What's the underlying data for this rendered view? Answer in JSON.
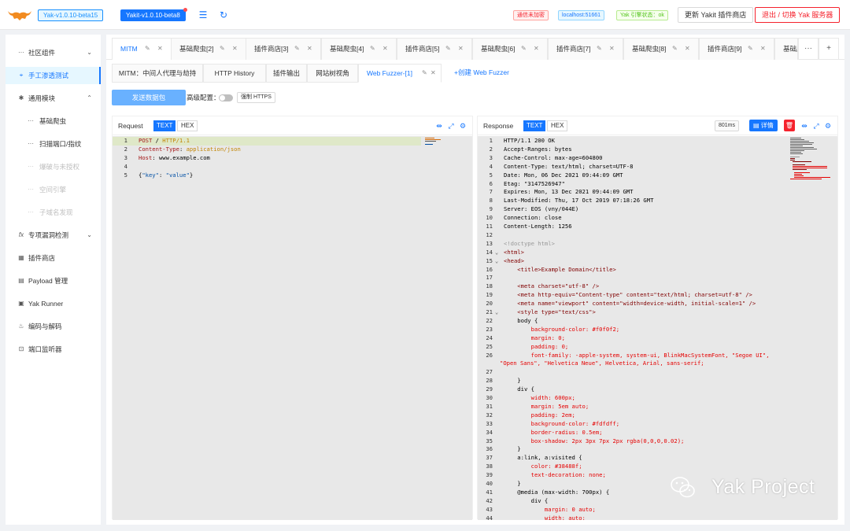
{
  "top": {
    "version_tag": "Yak-v1.0.10-beta15",
    "version_active": "Yakit-v1.0.10-beta8",
    "status_tags": [
      {
        "label": "通信未加密",
        "tone": "red"
      },
      {
        "label": "localhost:51661",
        "tone": "blue"
      },
      {
        "label": "Yak 引擎状态：ok",
        "tone": "green"
      }
    ],
    "update_label": "更新 Yakit 插件商店",
    "logout_label": "退出 / 切换 Yak 服务器",
    "accent": "#1677ff",
    "danger": "#f5222d"
  },
  "sidebar": {
    "items": [
      {
        "label": "社区组件",
        "icon": "ellipsis-icon",
        "arrow": "⌄"
      },
      {
        "label": "手工渗透测试",
        "icon": "target-icon",
        "active": true
      },
      {
        "label": "通用模块",
        "icon": "bug-icon",
        "arrow": "⌃"
      },
      {
        "label": "基础爬虫",
        "icon": "ellipsis-icon",
        "sub": true
      },
      {
        "label": "扫描端口/指纹",
        "icon": "ellipsis-icon",
        "sub": true
      },
      {
        "label": "爆破与未授权",
        "icon": "ellipsis-icon",
        "sub": true,
        "disabled": true
      },
      {
        "label": "空间引擎",
        "icon": "ellipsis-icon",
        "sub": true,
        "disabled": true
      },
      {
        "label": "子域名发现",
        "icon": "ellipsis-icon",
        "sub": true,
        "disabled": true
      },
      {
        "label": "专项漏洞检测",
        "icon": "function-icon",
        "arrow": "⌄"
      },
      {
        "label": "插件商店",
        "icon": "grid-icon"
      },
      {
        "label": "Payload 管理",
        "icon": "file-icon"
      },
      {
        "label": "Yak Runner",
        "icon": "terminal-icon"
      },
      {
        "label": "编码与解码",
        "icon": "fire-icon"
      },
      {
        "label": "端口监听器",
        "icon": "listen-icon"
      }
    ]
  },
  "tabs1": [
    "MITM",
    "基础爬虫[2]",
    "插件商店[3]",
    "基础爬虫[4]",
    "插件商店[5]",
    "基础爬虫[6]",
    "插件商店[7]",
    "基础爬虫[8]",
    "插件商店[9]",
    "基础爬"
  ],
  "tabs2": {
    "items": [
      "MITM：中间人代理与劫持",
      "HTTP History",
      "插件输出",
      "网站树视角",
      "Web Fuzzer-[1]"
    ],
    "create": "+创建 Web Fuzzer"
  },
  "toolbar": {
    "send_label": "发送数据包",
    "advanced_label": "高级配置：",
    "https_label": "强制 HTTPS"
  },
  "request": {
    "title": "Request",
    "text_label": "TEXT",
    "hex_label": "HEX",
    "lines": [
      {
        "n": "1",
        "parts": [
          [
            "POST",
            "k-red"
          ],
          [
            " / ",
            ""
          ],
          [
            "HTTP/1.1",
            "k-orange"
          ]
        ]
      },
      {
        "n": "2",
        "parts": [
          [
            "Content-Type",
            "k-red"
          ],
          [
            ": ",
            ""
          ],
          [
            "application/json",
            "k-orange"
          ]
        ]
      },
      {
        "n": "3",
        "parts": [
          [
            "Host",
            "k-red"
          ],
          [
            ": www.example.com",
            ""
          ]
        ]
      },
      {
        "n": "4",
        "parts": [
          [
            "",
            ""
          ]
        ]
      },
      {
        "n": "5",
        "parts": [
          [
            "{",
            ""
          ],
          [
            "\"key\"",
            "k-str"
          ],
          [
            ": ",
            ""
          ],
          [
            "\"value\"",
            "k-str"
          ],
          [
            "}",
            ""
          ]
        ]
      }
    ]
  },
  "response": {
    "title": "Response",
    "text_label": "TEXT",
    "hex_label": "HEX",
    "time_label": "801ms",
    "detail_label": "详情",
    "lines": [
      {
        "n": "1",
        "t": "HTTP/1.1 200 OK"
      },
      {
        "n": "2",
        "t": "Accept-Ranges: bytes"
      },
      {
        "n": "3",
        "t": "Cache-Control: max-age=604800"
      },
      {
        "n": "4",
        "t": "Content-Type: text/html; charset=UTF-8"
      },
      {
        "n": "5",
        "t": "Date: Mon, 06 Dec 2021 09:44:09 GMT"
      },
      {
        "n": "6",
        "t": "Etag: \"3147526947\""
      },
      {
        "n": "7",
        "t": "Expires: Mon, 13 Dec 2021 09:44:09 GMT"
      },
      {
        "n": "8",
        "t": "Last-Modified: Thu, 17 Oct 2019 07:18:26 GMT"
      },
      {
        "n": "9",
        "t": "Server: EOS (vny/044E)"
      },
      {
        "n": "10",
        "t": "Connection: close"
      },
      {
        "n": "11",
        "t": "Content-Length: 1256"
      },
      {
        "n": "12",
        "t": ""
      },
      {
        "n": "13",
        "t": "<!doctype html>",
        "c": "k-gray"
      },
      {
        "n": "14",
        "t": "<html>",
        "c": "k-tag",
        "fold": true
      },
      {
        "n": "15",
        "t": "<head>",
        "c": "k-tag",
        "fold": true
      },
      {
        "n": "16",
        "t": "    <title>Example Domain</title>",
        "c": "k-tag"
      },
      {
        "n": "17",
        "t": ""
      },
      {
        "n": "18",
        "t": "    <meta charset=\"utf-8\" />",
        "c": "k-tag"
      },
      {
        "n": "19",
        "t": "    <meta http-equiv=\"Content-type\" content=\"text/html; charset=utf-8\" />",
        "c": "k-tag"
      },
      {
        "n": "20",
        "t": "    <meta name=\"viewport\" content=\"width=device-width, initial-scale=1\" />",
        "c": "k-tag"
      },
      {
        "n": "21",
        "t": "    <style type=\"text/css\">",
        "c": "k-tag",
        "fold": true
      },
      {
        "n": "22",
        "t": "    body {"
      },
      {
        "n": "23",
        "t": "        background-color: #f0f0f2;",
        "c": "k-attr"
      },
      {
        "n": "24",
        "t": "        margin: 0;",
        "c": "k-attr"
      },
      {
        "n": "25",
        "t": "        padding: 0;",
        "c": "k-attr"
      },
      {
        "n": "26",
        "t": "        font-family: -apple-system, system-ui, BlinkMacSystemFont, \"Segoe UI\",",
        "c": "k-attr"
      },
      {
        "n": "",
        "t": "\"Open Sans\", \"Helvetica Neue\", Helvetica, Arial, sans-serif;",
        "c": "k-attr",
        "wrap": true
      },
      {
        "n": "27",
        "t": ""
      },
      {
        "n": "28",
        "t": "    }"
      },
      {
        "n": "29",
        "t": "    div {"
      },
      {
        "n": "30",
        "t": "        width: 600px;",
        "c": "k-attr"
      },
      {
        "n": "31",
        "t": "        margin: 5em auto;",
        "c": "k-attr"
      },
      {
        "n": "32",
        "t": "        padding: 2em;",
        "c": "k-attr"
      },
      {
        "n": "33",
        "t": "        background-color: #fdfdff;",
        "c": "k-attr"
      },
      {
        "n": "34",
        "t": "        border-radius: 0.5em;",
        "c": "k-attr"
      },
      {
        "n": "35",
        "t": "        box-shadow: 2px 3px 7px 2px rgba(0,0,0,0.02);",
        "c": "k-attr"
      },
      {
        "n": "36",
        "t": "    }"
      },
      {
        "n": "37",
        "t": "    a:link, a:visited {"
      },
      {
        "n": "38",
        "t": "        color: #38488f;",
        "c": "k-attr"
      },
      {
        "n": "39",
        "t": "        text-decoration: none;",
        "c": "k-attr"
      },
      {
        "n": "40",
        "t": "    }"
      },
      {
        "n": "41",
        "t": "    @media (max-width: 700px) {"
      },
      {
        "n": "42",
        "t": "        div {"
      },
      {
        "n": "43",
        "t": "            margin: 0 auto;",
        "c": "k-attr"
      },
      {
        "n": "44",
        "t": "            width: auto;",
        "c": "k-attr"
      }
    ]
  },
  "watermark": "Yak Project"
}
